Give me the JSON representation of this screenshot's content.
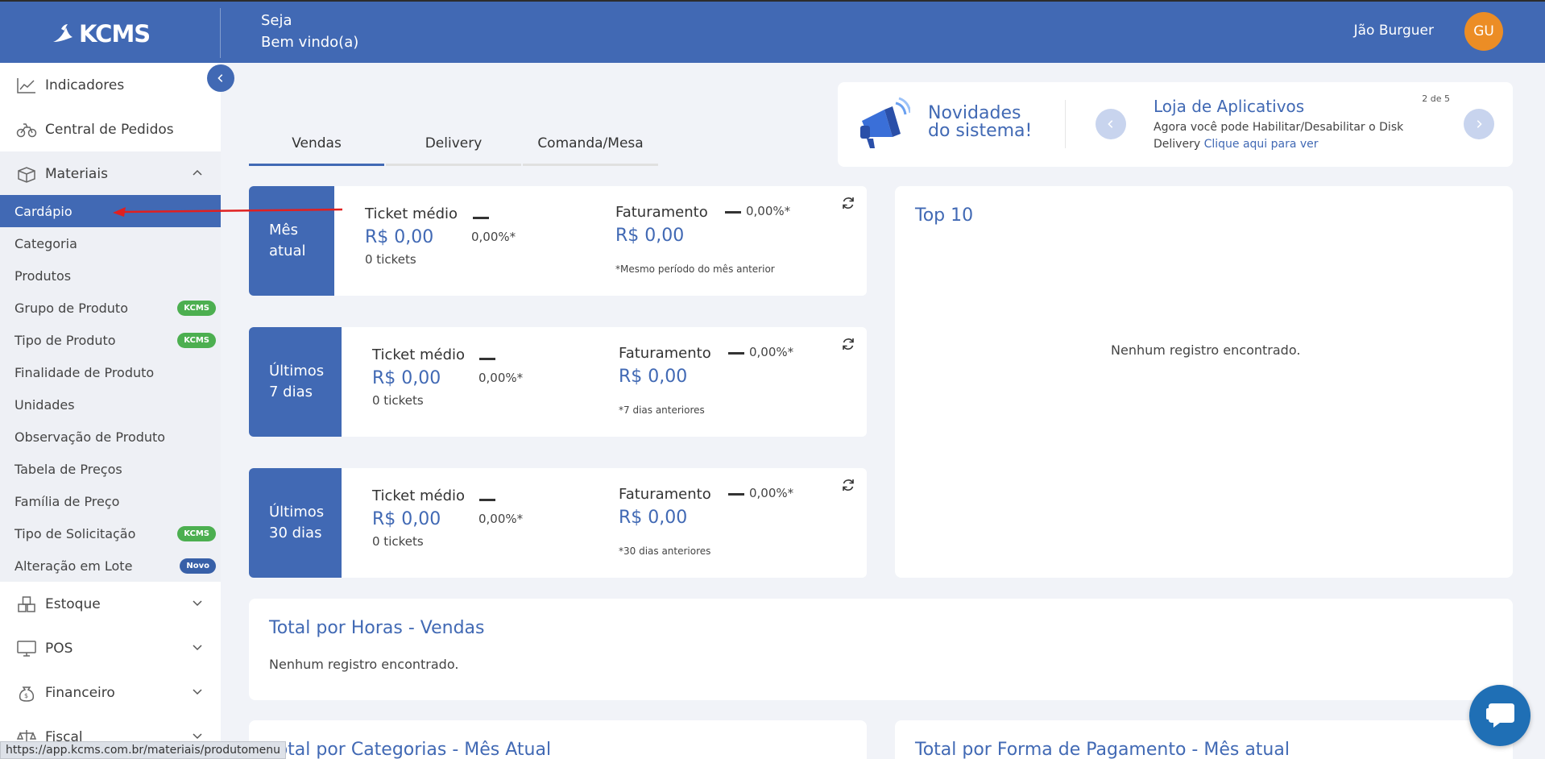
{
  "header": {
    "logo_text": "KCMS",
    "welcome_line1": "Seja",
    "welcome_line2": "Bem vindo(a)",
    "user_name": "Jão Burguer",
    "avatar_initials": "GU"
  },
  "sidebar": {
    "indicadores": "Indicadores",
    "central_pedidos": "Central de Pedidos",
    "materiais": "Materiais",
    "sub_items": [
      {
        "label": "Cardápio"
      },
      {
        "label": "Categoria"
      },
      {
        "label": "Produtos"
      },
      {
        "label": "Grupo de Produto",
        "badge": "KCMS"
      },
      {
        "label": "Tipo de Produto",
        "badge": "KCMS"
      },
      {
        "label": "Finalidade de Produto"
      },
      {
        "label": "Unidades"
      },
      {
        "label": "Observação de Produto"
      },
      {
        "label": "Tabela de Preços"
      },
      {
        "label": "Família de Preço"
      },
      {
        "label": "Tipo de Solicitação",
        "badge": "KCMS"
      },
      {
        "label": "Alteração em Lote",
        "badge": "Novo"
      }
    ],
    "estoque": "Estoque",
    "pos": "POS",
    "financeiro": "Financeiro",
    "fiscal": "Fiscal"
  },
  "tabs": [
    "Vendas",
    "Delivery",
    "Comanda/Mesa"
  ],
  "news": {
    "title_line1": "Novidades",
    "title_line2": "do sistema!",
    "app_title": "Loja de Aplicativos",
    "app_text": "Agora você pode Habilitar/Desabilitar o Disk Delivery",
    "app_link": "Clique aqui para ver",
    "counter": "2 de 5"
  },
  "stats": [
    {
      "period_line1": "Mês",
      "period_line2": "atual",
      "ticket_label": "Ticket médio",
      "ticket_value": "R$ 0,00",
      "ticket_pct": "0,00%*",
      "tickets": "0 tickets",
      "fat_label": "Faturamento",
      "fat_pct": "0,00%*",
      "fat_value": "R$ 0,00",
      "note": "*Mesmo período do mês anterior"
    },
    {
      "period_line1": "Últimos",
      "period_line2": "7 dias",
      "ticket_label": "Ticket médio",
      "ticket_value": "R$ 0,00",
      "ticket_pct": "0,00%*",
      "tickets": "0 tickets",
      "fat_label": "Faturamento",
      "fat_pct": "0,00%*",
      "fat_value": "R$ 0,00",
      "note": "*7 dias anteriores"
    },
    {
      "period_line1": "Últimos",
      "period_line2": "30 dias",
      "ticket_label": "Ticket médio",
      "ticket_value": "R$ 0,00",
      "ticket_pct": "0,00%*",
      "tickets": "0 tickets",
      "fat_label": "Faturamento",
      "fat_pct": "0,00%*",
      "fat_value": "R$ 0,00",
      "note": "*30 dias anteriores"
    }
  ],
  "top10": {
    "title": "Top 10",
    "empty": "Nenhum registro encontrado."
  },
  "horas": {
    "title": "Total por Horas - Vendas",
    "empty": "Nenhum registro encontrado."
  },
  "categorias": {
    "title": "Total por Categorias - Mês Atual"
  },
  "pagamento": {
    "title": "Total por Forma de Pagamento - Mês atual"
  },
  "status_url": "https://app.kcms.com.br/materiais/produtomenu",
  "colors": {
    "primary": "#4169b4",
    "avatar": "#ec8d25",
    "badge_green": "#4caf50",
    "arrow": "#e02020"
  }
}
